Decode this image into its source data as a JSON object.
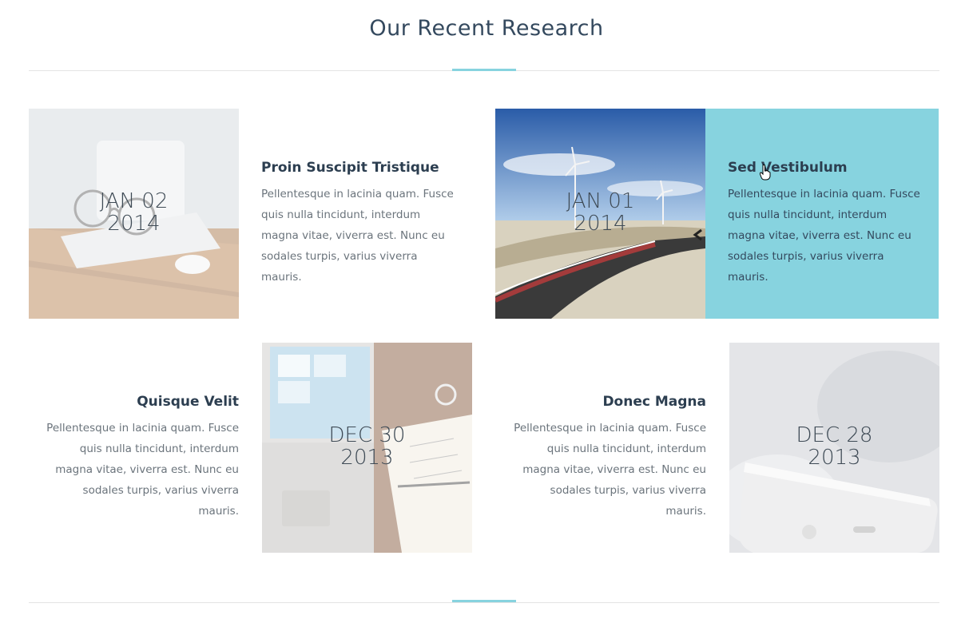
{
  "section": {
    "title": "Our Recent Research"
  },
  "posts": [
    {
      "title": "Proin Suscipit Tristique",
      "excerpt": "Pellentesque in lacinia quam. Fusce quis nulla tincidunt, interdum magna vitae, viverra est. Nunc eu sodales turpis, varius viverra mauris.",
      "date_month_day": "JAN 02",
      "date_year": "2014",
      "image": "desk-laptop-glasses-photo"
    },
    {
      "title": "Sed Vestibulum",
      "excerpt": "Pellentesque in lacinia quam. Fusce quis nulla tincidunt, interdum magna vitae, viverra est. Nunc eu sodales turpis, varius viverra mauris.",
      "date_month_day": "JAN 01",
      "date_year": "2014",
      "image": "road-wind-turbines-photo",
      "state": "hover"
    },
    {
      "title": "Quisque Velit",
      "excerpt": "Pellentesque in lacinia quam. Fusce quis nulla tincidunt, interdum magna vitae, viverra est. Nunc eu sodales turpis, varius viverra mauris.",
      "date_month_day": "DEC 30",
      "date_year": "2013",
      "image": "laptop-notebook-photo"
    },
    {
      "title": "Donec Magna",
      "excerpt": "Pellentesque in lacinia quam. Fusce quis nulla tincidunt, interdum magna vitae, viverra est. Nunc eu sodales turpis, varius viverra mauris.",
      "date_month_day": "DEC 28",
      "date_year": "2013",
      "image": "smartphone-photo"
    }
  ],
  "colors": {
    "accent": "#87d3df",
    "heading": "#2c3e50",
    "body_text": "#6b747c",
    "rule": "#e4e4e4"
  },
  "cursor": {
    "icon": "hand-pointer-icon"
  }
}
